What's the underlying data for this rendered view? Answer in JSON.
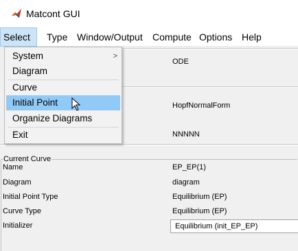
{
  "window": {
    "title": "Matcont GUI",
    "icon": "matlab-icon"
  },
  "menubar": {
    "items": [
      {
        "label": "Select"
      },
      {
        "label": "Type"
      },
      {
        "label": "Window/Output"
      },
      {
        "label": "Compute"
      },
      {
        "label": "Options"
      },
      {
        "label": "Help"
      }
    ]
  },
  "select_menu": {
    "items": [
      {
        "label": "System",
        "has_submenu": true
      },
      {
        "label": "Diagram"
      },
      {
        "label": "Curve"
      },
      {
        "label": "Initial Point"
      },
      {
        "label": "Organize Diagrams"
      },
      {
        "label": "Exit"
      }
    ],
    "submenu_arrow": ">"
  },
  "system_panel": {
    "type_value": "ODE",
    "system_name": "HopfNormalForm",
    "coordinates": "NNNNN"
  },
  "current_curve": {
    "title": "Current Curve",
    "rows": [
      {
        "label": "Name",
        "value": "EP_EP(1)"
      },
      {
        "label": "Diagram",
        "value": "diagram"
      },
      {
        "label": "Initial Point Type",
        "value": "Equilibrium (EP)"
      },
      {
        "label": "Curve Type",
        "value": "Equilibrium (EP)"
      },
      {
        "label": "Initializer",
        "value": "Equilibrium (init_EP_EP)"
      }
    ]
  },
  "colors": {
    "menu_active": "#cce4f7",
    "item_hover": "#91c9f7",
    "background": "#f0f0f0"
  }
}
